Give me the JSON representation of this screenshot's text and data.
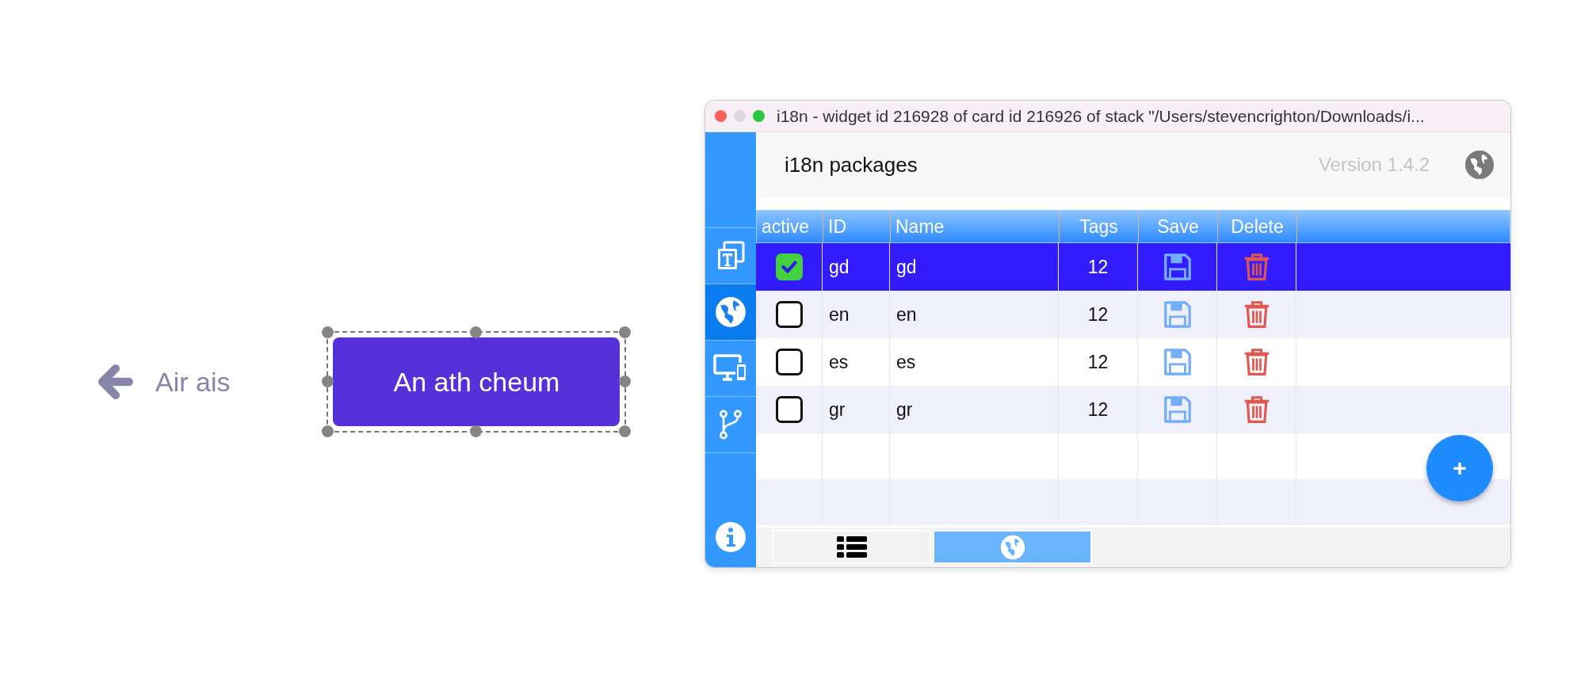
{
  "canvas": {
    "back_link": {
      "label": "Air ais"
    },
    "button": {
      "label": "An ath cheum",
      "selected": true
    }
  },
  "window": {
    "title": "i18n - widget id 216928 of card id 216926 of stack \"/Users/stevencrighton/Downloads/i..."
  },
  "sidebar": {
    "items": [
      {
        "kind": "text",
        "selected": false
      },
      {
        "kind": "globe",
        "selected": true
      },
      {
        "kind": "devices",
        "selected": false
      },
      {
        "kind": "branch",
        "selected": false
      }
    ]
  },
  "header": {
    "title": "i18n packages",
    "version": "Version 1.4.2"
  },
  "table": {
    "columns": [
      "active",
      "ID",
      "Name",
      "Tags",
      "Save",
      "Delete"
    ],
    "rows": [
      {
        "active": true,
        "selected": true,
        "id": "gd",
        "name": "gd",
        "tags": "12"
      },
      {
        "active": false,
        "selected": false,
        "id": "en",
        "name": "en",
        "tags": "12"
      },
      {
        "active": false,
        "selected": false,
        "id": "es",
        "name": "es",
        "tags": "12"
      },
      {
        "active": false,
        "selected": false,
        "id": "gr",
        "name": "gr",
        "tags": "12"
      }
    ]
  },
  "add_button": {
    "label": "+"
  },
  "bottom_tabs": [
    {
      "kind": "list",
      "selected": false
    },
    {
      "kind": "globe",
      "selected": true
    }
  ]
}
